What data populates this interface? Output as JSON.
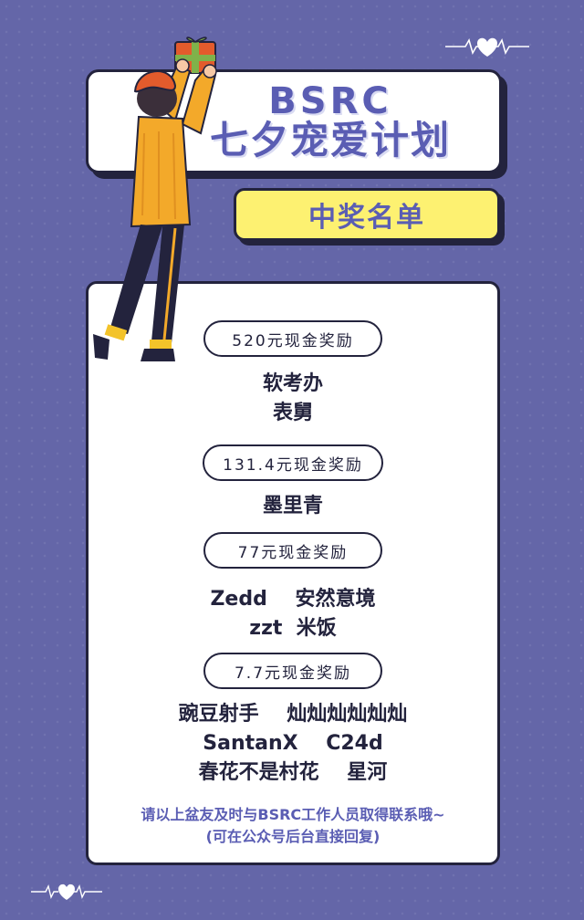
{
  "header": {
    "title_line1": "BSRC",
    "title_line2": "七夕宠爱计划"
  },
  "banner": {
    "label": "中奖名单"
  },
  "prizes": [
    {
      "label": "520元现金奖励",
      "winners": [
        "软考办",
        "表舅"
      ]
    },
    {
      "label": "131.4元现金奖励",
      "winners": [
        "墨里青"
      ]
    },
    {
      "label": "77元现金奖励",
      "winners": [
        "Zedd    安然意境",
        "zzt  米饭"
      ]
    },
    {
      "label": "7.7元现金奖励",
      "winners": [
        "豌豆射手    灿灿灿灿灿灿",
        "SantanX    C24d",
        "春花不是村花    星河"
      ]
    }
  ],
  "footer": {
    "line1": "请以上盆友及时与BSRC工作人员取得联系哦~",
    "line2": "(可在公众号后台直接回复)"
  },
  "colors": {
    "background": "#6466a8",
    "accent": "#5a5db3",
    "banner": "#fdf171",
    "outline": "#23233d"
  }
}
